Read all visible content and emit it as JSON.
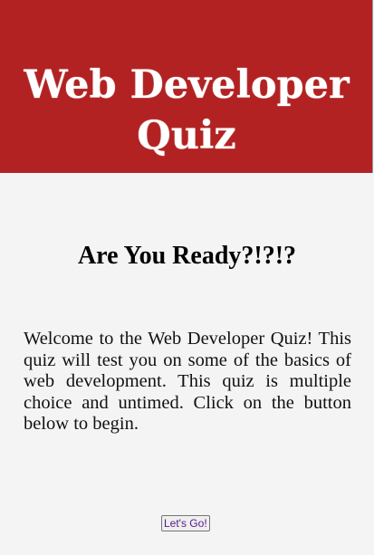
{
  "header": {
    "title": "Web Developer Quiz"
  },
  "main": {
    "subtitle": "Are You Ready?!?!?",
    "intro": "Welcome to the Web Developer Quiz! This quiz will test you on some of the basics of web development. This quiz is multiple choice and untimed. Click on the button below to begin.",
    "start_button_label": "Let's Go!"
  },
  "colors": {
    "header_background": "#b22222",
    "page_background": "#f4f4f4",
    "button_text": "#551a8b"
  }
}
